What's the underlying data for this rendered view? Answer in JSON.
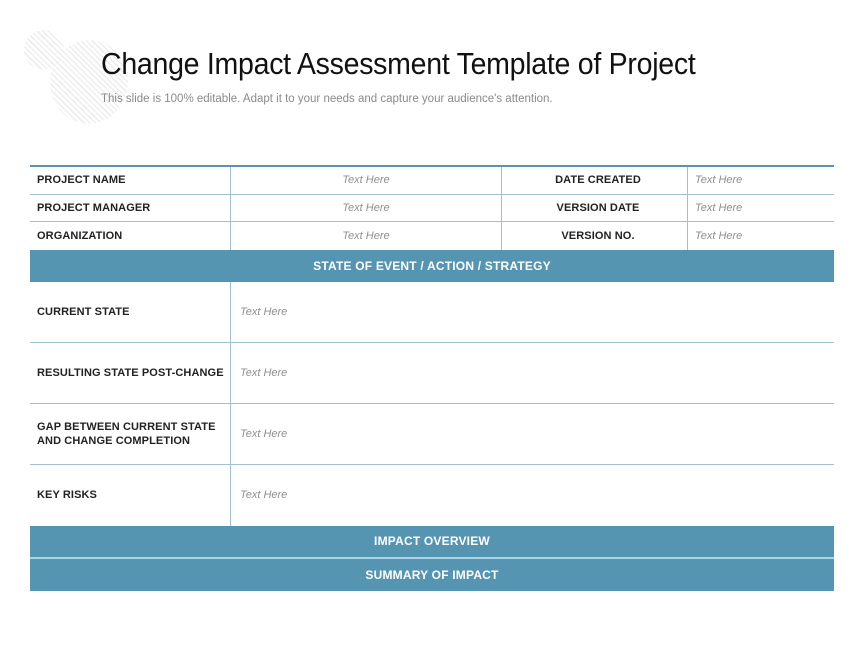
{
  "header": {
    "title": "Change Impact Assessment Template of Project",
    "subtitle": "This slide is 100% editable. Adapt it to your needs and capture your audience's attention."
  },
  "info_rows": [
    {
      "label": "PROJECT NAME",
      "value": "Text Here",
      "label2": "DATE CREATED",
      "value2": "Text Here"
    },
    {
      "label": "PROJECT MANAGER",
      "value": "Text Here",
      "label2": "VERSION DATE",
      "value2": "Text Here"
    },
    {
      "label": "ORGANIZATION",
      "value": "Text Here",
      "label2": "VERSION NO.",
      "value2": "Text Here"
    }
  ],
  "state_header": "STATE OF EVENT / ACTION / STRATEGY",
  "state_rows": [
    {
      "label": "CURRENT STATE",
      "value": "Text Here"
    },
    {
      "label": "RESULTING STATE POST-CHANGE",
      "value": "Text Here"
    },
    {
      "label": "GAP BETWEEN CURRENT STATE AND CHANGE COMPLETION",
      "value": "Text Here"
    },
    {
      "label": "KEY RISKS",
      "value": "Text Here"
    }
  ],
  "impact_header": "IMPACT OVERVIEW",
  "summary_header": "SUMMARY OF IMPACT",
  "colors": {
    "accent": "#5595b2",
    "divider": "#9fc1d1"
  }
}
